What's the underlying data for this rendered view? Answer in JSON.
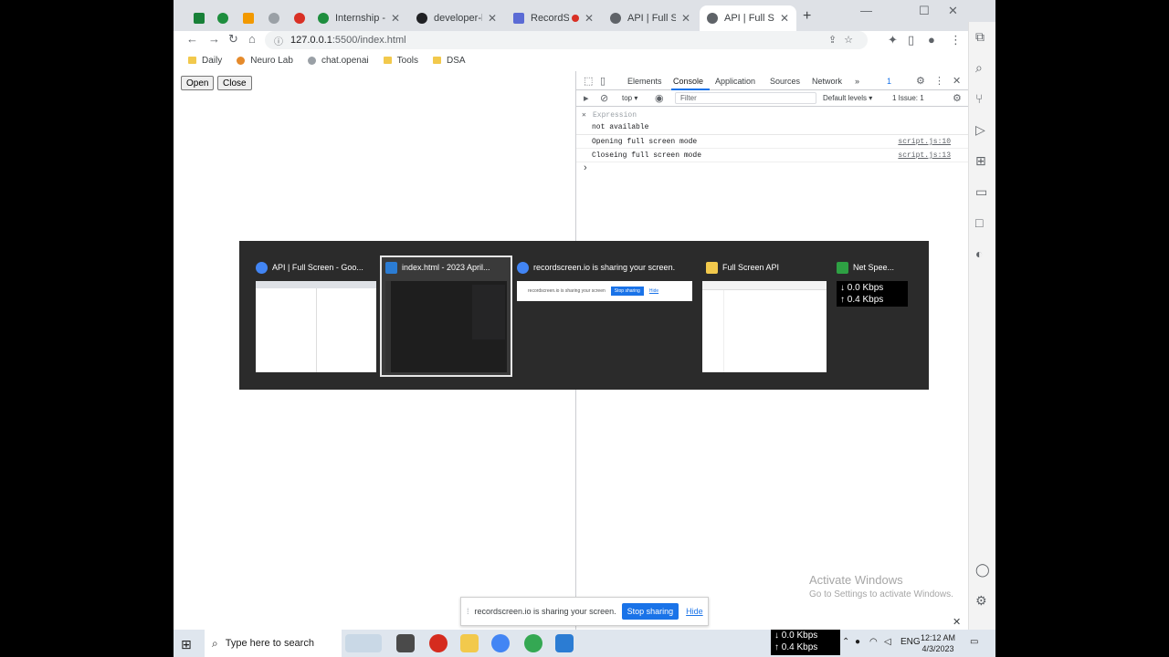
{
  "browser": {
    "tabs": [
      {
        "label": "",
        "color": "#188038"
      },
      {
        "label": "",
        "color": "#1e8e3e"
      },
      {
        "label": "",
        "color": "#f29900"
      },
      {
        "label": "",
        "color": "#9aa0a6"
      },
      {
        "label": "",
        "color": "#d93025"
      },
      {
        "label": "Internship - Writ",
        "color": "#1e8e3e"
      },
      {
        "label": "developer-karan",
        "color": "#202124"
      },
      {
        "label": "RecordScree",
        "color": "#5b6bd5"
      },
      {
        "label": "API | Full Screen",
        "color": "#5f6368"
      },
      {
        "label": "API | Full Screen",
        "color": "#5f6368"
      }
    ],
    "url_host": "127.0.0.1",
    "url_path": ":5500/index.html",
    "bookmarks": [
      "Daily",
      "Neuro Lab",
      "chat.openai",
      "Tools",
      "DSA"
    ]
  },
  "page": {
    "open_label": "Open",
    "close_label": "Close"
  },
  "devtools": {
    "tabs": [
      "Elements",
      "Console",
      "Application",
      "Sources",
      "Network"
    ],
    "more": "»",
    "badge": "1",
    "context": "top ▾",
    "filter_placeholder": "Filter",
    "levels": "Default levels ▾",
    "issues": "1 Issue: 1",
    "expression_label": "Expression",
    "expression_value": "not available",
    "logs": [
      {
        "msg": "Opening full screen mode",
        "src": "script.js:10"
      },
      {
        "msg": "Closeing full screen mode",
        "src": "script.js:13"
      }
    ]
  },
  "watermark": {
    "line1": "Activate Windows",
    "line2": "Go to Settings to activate Windows."
  },
  "sharebar": {
    "text": "recordscreen.io is sharing your screen.",
    "stop": "Stop sharing",
    "hide": "Hide"
  },
  "switcher": {
    "windows": [
      {
        "title": "API | Full Screen - Goo...",
        "icon_color": "#4285f4"
      },
      {
        "title": "index.html - 2023 April...",
        "icon_color": "#2b7cd3"
      },
      {
        "title": "recordscreen.io is sharing your screen.",
        "icon_color": "#4285f4"
      },
      {
        "title": "Full Screen API",
        "icon_color": "#f2c94c"
      },
      {
        "title": "Net Spee...",
        "icon_color": "#2ea043"
      }
    ],
    "mini_share_text": "recordscreen.io is sharing your screen",
    "mini_stop": "Stop sharing",
    "mini_hide": "Hide",
    "net_down": "↓ 0.0 Kbps",
    "net_up": "↑ 0.4 Kbps"
  },
  "taskbar": {
    "search_placeholder": "Type here to search",
    "net_down": "↓ 0.0 Kbps",
    "net_up": "↑ 0.4 Kbps",
    "lang": "ENG",
    "time": "12:12 AM",
    "date": "4/3/2023"
  }
}
